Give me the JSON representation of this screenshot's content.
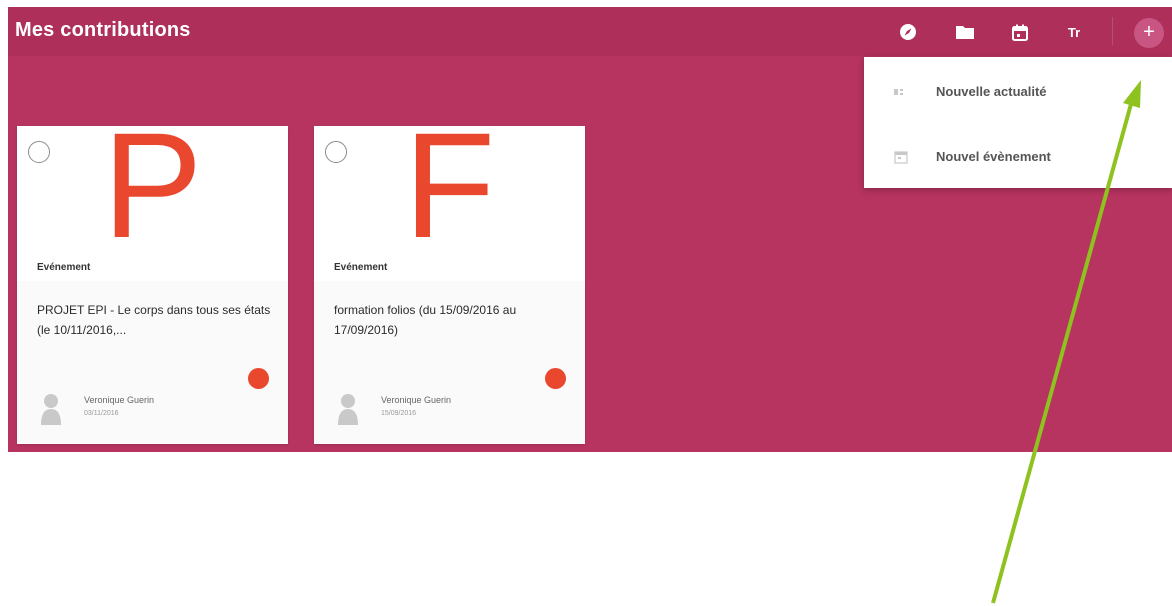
{
  "header": {
    "title": "Mes contributions",
    "icons": [
      "compass-icon",
      "folder-icon",
      "calendar-icon",
      "text-size-icon"
    ],
    "text_size_glyph": "Tr",
    "add_glyph": "+"
  },
  "cards": [
    {
      "letter": "P",
      "type": "Evénement",
      "title": "PROJET EPI - Le corps dans tous ses états (le 10/11/2016,...",
      "author": "Veronique Guerin",
      "date": "03/11/2016"
    },
    {
      "letter": "F",
      "type": "Evénement",
      "title": "formation folios (du 15/09/2016 au 17/09/2016)",
      "author": "Veronique Guerin",
      "date": "15/09/2016"
    }
  ],
  "menu": {
    "items": [
      {
        "label": "Nouvelle actualité",
        "icon": "news-icon"
      },
      {
        "label": "Nouvel évènement",
        "icon": "calendar-icon"
      }
    ]
  },
  "colors": {
    "accent": "#b6345f",
    "header": "#ad2f5a",
    "letter": "#e9472e",
    "arrow": "#8dc21f"
  }
}
